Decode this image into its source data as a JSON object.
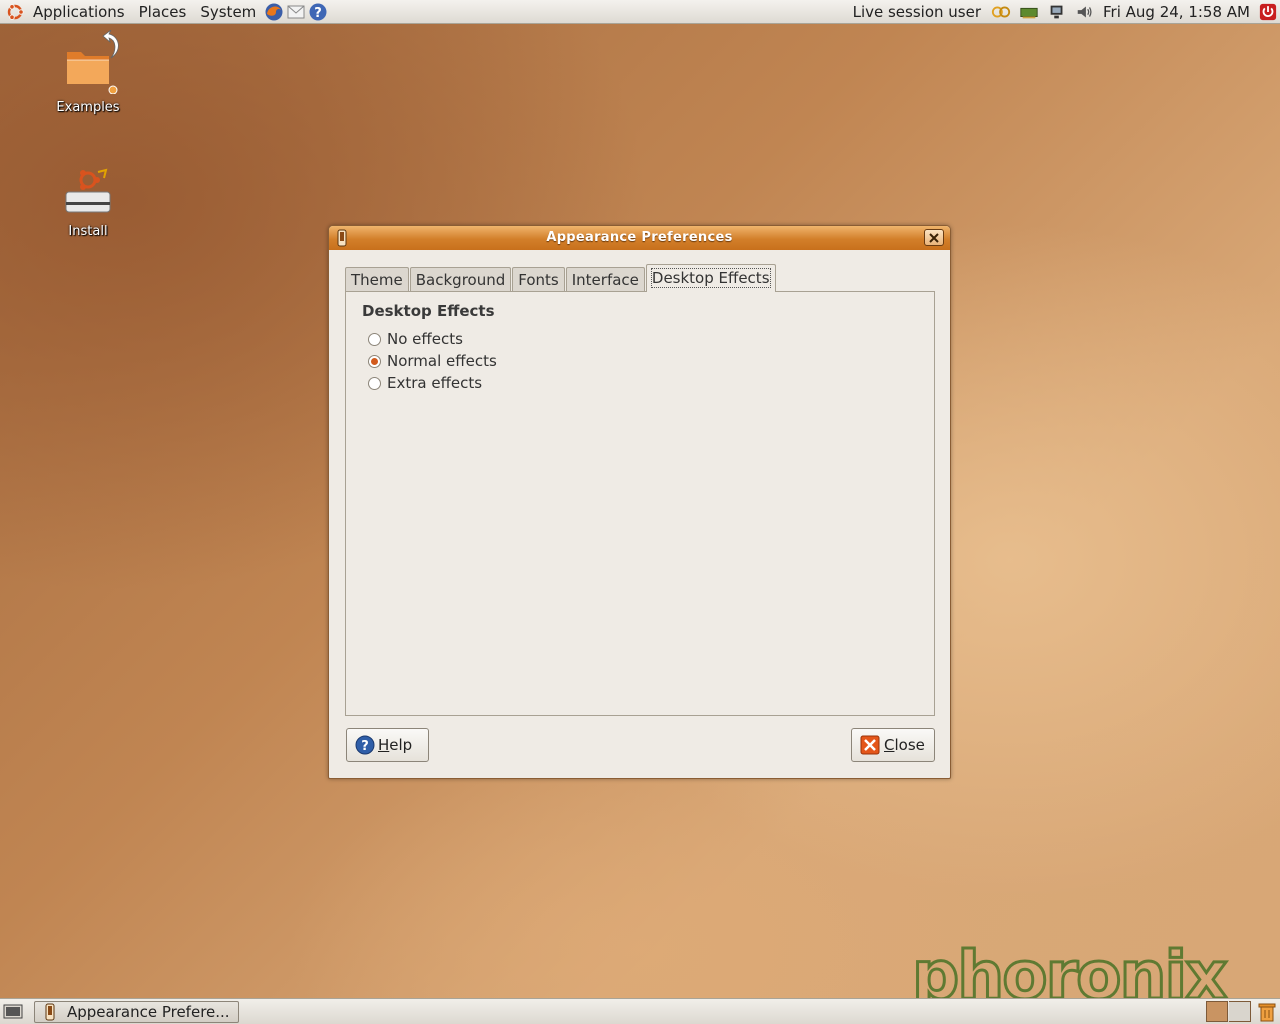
{
  "top_panel": {
    "menus": [
      "Applications",
      "Places",
      "System"
    ],
    "user": "Live session user",
    "clock": "Fri Aug 24,  1:58 AM"
  },
  "desktop_icons": [
    {
      "label": "Examples"
    },
    {
      "label": "Install"
    }
  ],
  "dialog": {
    "title": "Appearance Preferences",
    "tabs": [
      "Theme",
      "Background",
      "Fonts",
      "Interface",
      "Desktop Effects"
    ],
    "active_tab": "Desktop Effects",
    "section_title": "Desktop Effects",
    "options": [
      {
        "label": "No effects",
        "checked": false
      },
      {
        "label": "Normal effects",
        "checked": true
      },
      {
        "label": "Extra effects",
        "checked": false
      }
    ],
    "help_mnemonic": "H",
    "help_rest": "elp",
    "close_mnemonic": "C",
    "close_rest": "lose"
  },
  "taskbar": {
    "window_button": "Appearance Prefere..."
  },
  "watermark": "phoronix",
  "colors": {
    "title_orange": "#d27f2a",
    "radio_selected": "#d25a1c",
    "watermark_green": "#5f7a32"
  }
}
